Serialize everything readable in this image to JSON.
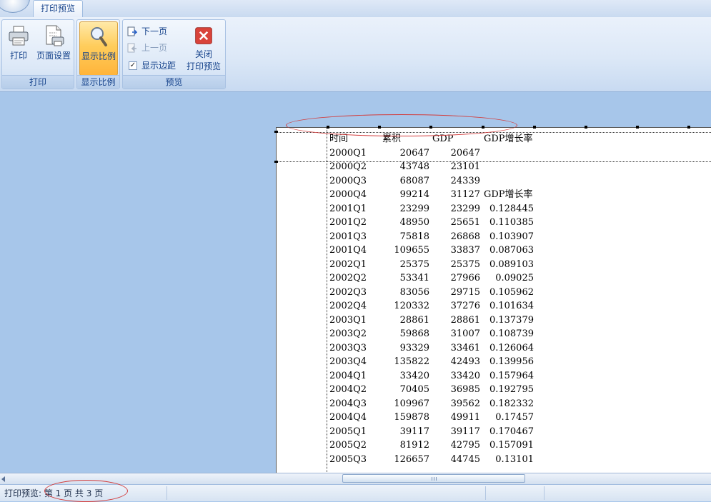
{
  "ribbon": {
    "tab_label": "打印预览",
    "groups": {
      "print": {
        "label": "打印",
        "print_button": "打印",
        "page_setup_button": "页面设置"
      },
      "zoom": {
        "label": "显示比例",
        "zoom_button": "显示比例"
      },
      "preview": {
        "label": "预览",
        "next_page": "下一页",
        "prev_page": "上一页",
        "show_margins": "显示边距",
        "show_margins_checked": true,
        "close_label_line1": "关闭",
        "close_label_line2": "打印预览"
      }
    }
  },
  "sheet": {
    "header": [
      "时间",
      "累积",
      "GDP",
      "GDP增长率"
    ],
    "rows": [
      [
        "2000Q1",
        "20647",
        "20647",
        ""
      ],
      [
        "2000Q2",
        "43748",
        "23101",
        ""
      ],
      [
        "2000Q3",
        "68087",
        "24339",
        ""
      ],
      [
        "2000Q4",
        "99214",
        "31127",
        "GDP增长率"
      ],
      [
        "2001Q1",
        "23299",
        "23299",
        "0.128445"
      ],
      [
        "2001Q2",
        "48950",
        "25651",
        "0.110385"
      ],
      [
        "2001Q3",
        "75818",
        "26868",
        "0.103907"
      ],
      [
        "2001Q4",
        "109655",
        "33837",
        "0.087063"
      ],
      [
        "2002Q1",
        "25375",
        "25375",
        "0.089103"
      ],
      [
        "2002Q2",
        "53341",
        "27966",
        "0.09025"
      ],
      [
        "2002Q3",
        "83056",
        "29715",
        "0.105962"
      ],
      [
        "2002Q4",
        "120332",
        "37276",
        "0.101634"
      ],
      [
        "2003Q1",
        "28861",
        "28861",
        "0.137379"
      ],
      [
        "2003Q2",
        "59868",
        "31007",
        "0.108739"
      ],
      [
        "2003Q3",
        "93329",
        "33461",
        "0.126064"
      ],
      [
        "2003Q4",
        "135822",
        "42493",
        "0.139956"
      ],
      [
        "2004Q1",
        "33420",
        "33420",
        "0.157964"
      ],
      [
        "2004Q2",
        "70405",
        "36985",
        "0.192795"
      ],
      [
        "2004Q3",
        "109967",
        "39562",
        "0.182332"
      ],
      [
        "2004Q4",
        "159878",
        "49911",
        "0.17457"
      ],
      [
        "2005Q1",
        "39117",
        "39117",
        "0.170467"
      ],
      [
        "2005Q2",
        "81912",
        "42795",
        "0.157091"
      ],
      [
        "2005Q3",
        "126657",
        "44745",
        "0.13101"
      ]
    ]
  },
  "status_bar": {
    "text": "打印预览: 第 1 页 共 3 页"
  },
  "colors": {
    "annotation_oval": "#d23c3c",
    "active_button": "#ffcd5c",
    "ribbon_text": "#15428b"
  }
}
